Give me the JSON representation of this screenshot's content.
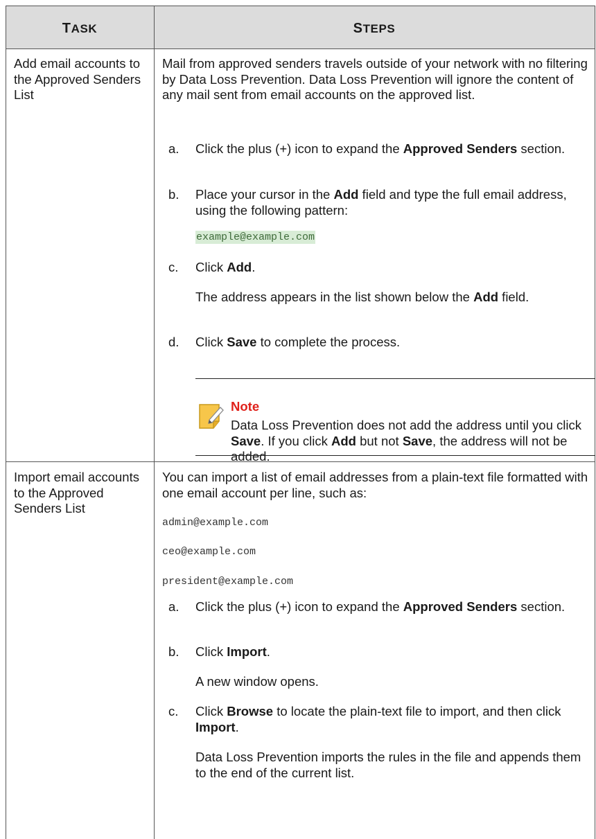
{
  "header": {
    "task_first": "T",
    "task_rest": "ASK",
    "steps_first": "S",
    "steps_rest": "TEPS"
  },
  "row1": {
    "task": "Add email accounts to the Approved Senders List",
    "intro": "Mail from approved senders travels outside of your network with no filtering by Data Loss Prevention. Data Loss Prevention will ignore the content of any mail sent from email accounts on the approved list.",
    "steps": {
      "a": {
        "letter": "a.",
        "pre": "Click the plus (+) icon to expand the ",
        "bold": "Approved Senders",
        "post": " section."
      },
      "b": {
        "letter": "b.",
        "pre": "Place your cursor in the ",
        "bold": "Add",
        "post": " field and type the full email address, using the following pattern:",
        "code": "example@example.com"
      },
      "c": {
        "letter": "c.",
        "pre": "Click ",
        "bold": "Add",
        "post": "."
      },
      "c_result": {
        "pre": "The address appears in the list shown below the ",
        "bold": "Add",
        "post": " field."
      },
      "d": {
        "letter": "d.",
        "pre": "Click ",
        "bold": "Save",
        "post": " to complete the process."
      }
    },
    "note": {
      "title": "Note",
      "pre": "Data Loss Prevention does not add the address until you click ",
      "bold1": "Save",
      "mid": ". If you click ",
      "bold2": "Add",
      "mid2": " but not ",
      "bold3": "Save",
      "post": ", the address will not be added."
    }
  },
  "row2": {
    "task": "Import email accounts to the Approved Senders List",
    "intro": "You can import a list of email addresses from a plain-text file formatted with one email account per line, such as:",
    "examples": [
      "admin@example.com",
      "ceo@example.com",
      "president@example.com"
    ],
    "steps": {
      "a": {
        "letter": "a.",
        "pre": "Click the plus (+) icon to expand the ",
        "bold": "Approved Senders",
        "post": " section."
      },
      "b": {
        "letter": "b.",
        "pre": "Click ",
        "bold": "Import",
        "post": "."
      },
      "b_result": "A new window opens.",
      "c": {
        "letter": "c.",
        "pre": "Click ",
        "bold": "Browse",
        "mid": " to locate the plain-text file to import, and then click ",
        "bold2": "Import",
        "post": "."
      },
      "c_result": "Data Loss Prevention imports the rules in the file and appends them to the end of the current list."
    }
  },
  "colors": {
    "header_bg": "#dcdcdc",
    "note_title": "#e0211b",
    "code_highlight": "#d8ecd6",
    "rule": "#555555"
  }
}
